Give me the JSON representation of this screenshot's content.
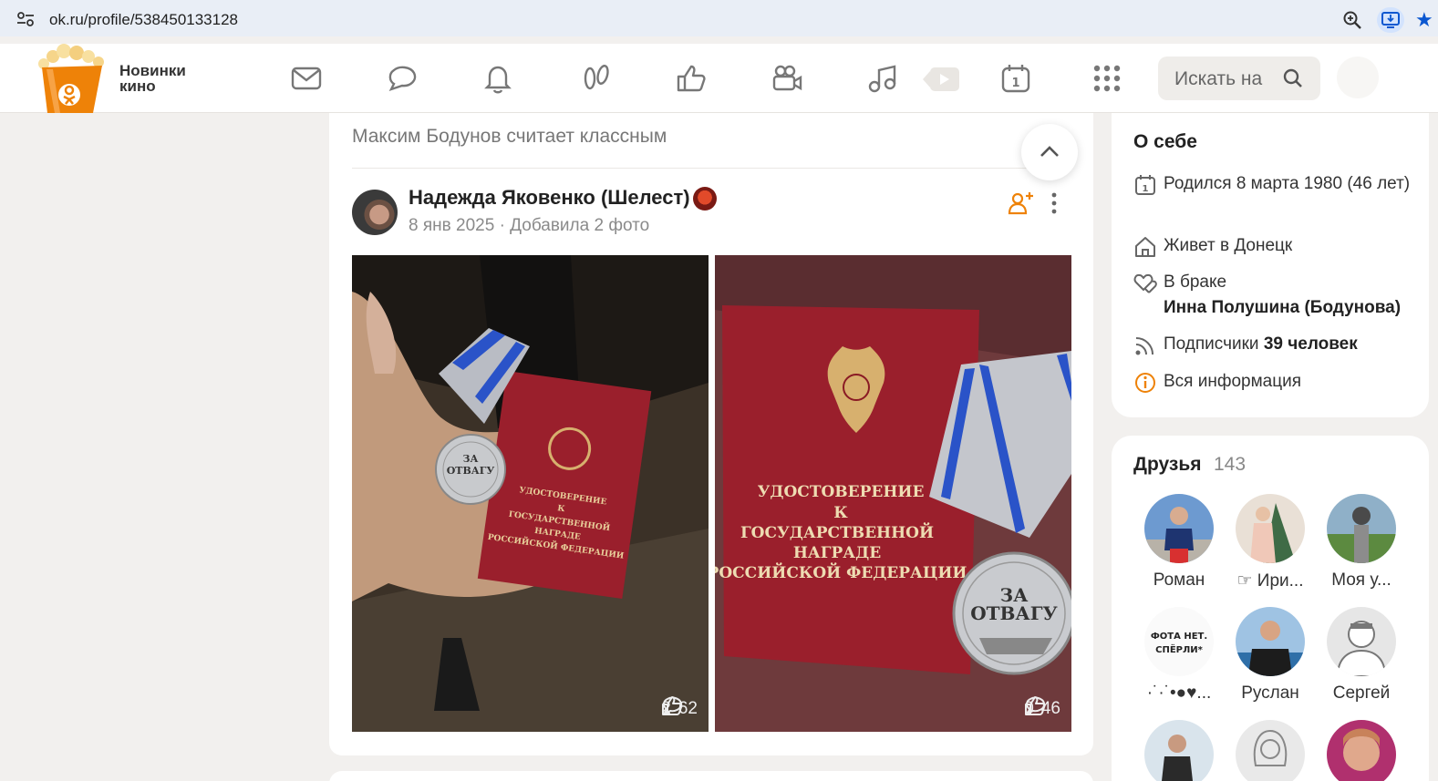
{
  "browser": {
    "url": "ok.ru/profile/538450133128",
    "icons": [
      "tune-icon",
      "zoom-icon",
      "install-app-icon",
      "bookmark-star-icon"
    ]
  },
  "header": {
    "logo_caption_line1": "Новинки",
    "logo_caption_line2": "кино",
    "nav_icons": [
      "messages-icon",
      "discussions-icon",
      "notifications-icon",
      "guests-icon",
      "events-like-icon",
      "video-camera-icon",
      "music-icon",
      "video-icon",
      "calendar-icon",
      "apps-grid-icon"
    ],
    "search_placeholder": "Искать на"
  },
  "feed": {
    "context": "Максим Бодунов считает классным",
    "post": {
      "author": "Надежда Яковенко (Шелест)",
      "date": "8 янв 2025",
      "separator": "·",
      "action": "Добавила 2 фото",
      "photos": [
        {
          "comments": "2",
          "likes": "62",
          "medal_text_1": "ЗА",
          "medal_text_2": "ОТВАГУ",
          "doc_text": [
            "УДОСТОВЕРЕНИЕ",
            "К",
            "ГОСУДАРСТВЕННОЙ",
            "НАГРАДЕ",
            "РОССИЙСКОЙ ФЕДЕРАЦИИ"
          ]
        },
        {
          "comments": "0",
          "likes": "46",
          "medal_text_1": "ЗА",
          "medal_text_2": "ОТВАГУ",
          "doc_text": [
            "УДОСТОВЕРЕНИЕ",
            "К",
            "ГОСУДАРСТВЕННОЙ",
            "НАГРАДЕ",
            "РОССИЙСКОЙ ФЕДЕРАЦИИ"
          ]
        }
      ]
    }
  },
  "about": {
    "title": "О себе",
    "born": "Родился 8 марта 1980 (46 лет)",
    "lives": "Живет в Донецк",
    "marital": "В браке",
    "spouse": "Инна Полушина (Бодунова)",
    "followers_label": "Подписчики",
    "followers_value": "39 человек",
    "all_info": "Вся информация"
  },
  "friends": {
    "title": "Друзья",
    "count": "143",
    "items": [
      {
        "name": "Роман"
      },
      {
        "name": "☞ Ири..."
      },
      {
        "name": "Моя у..."
      },
      {
        "name": "·˙·˙•●♥..."
      },
      {
        "name": "Руслан"
      },
      {
        "name": "Сергей"
      },
      {
        "name": ""
      },
      {
        "name": ""
      },
      {
        "name": ""
      }
    ],
    "sticker_text_1": "ФОТА НЕТ.",
    "sticker_text_2": "СПЁРЛИ*"
  },
  "colors": {
    "accent": "#ee8208",
    "background": "#f2f0ee",
    "browser_bar": "#e9eef6",
    "doc_red": "#9a1f2c"
  }
}
